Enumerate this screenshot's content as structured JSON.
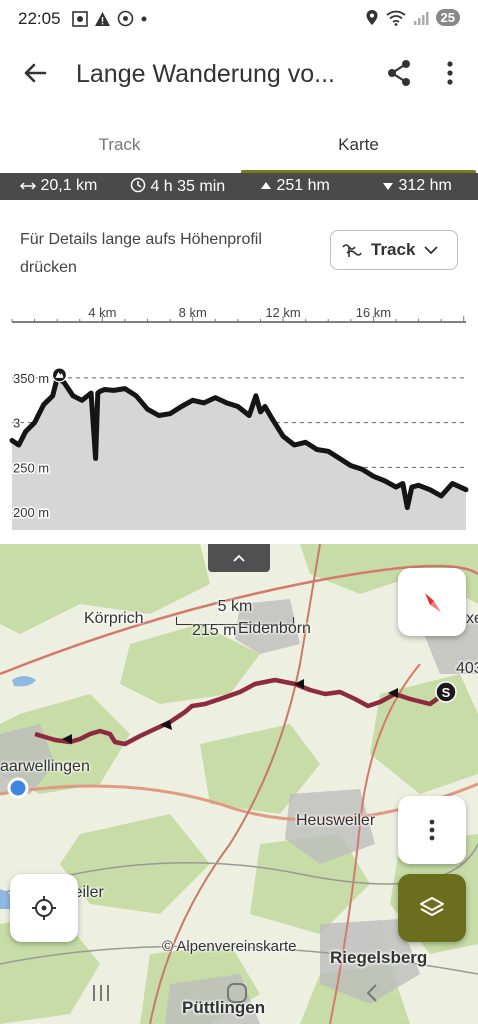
{
  "status_bar": {
    "time": "22:05",
    "battery": "25",
    "icons_left": [
      "screenshot-icon",
      "warning-icon",
      "whatsapp-icon",
      "dot-icon"
    ],
    "icons_right": [
      "location-icon",
      "wifi-icon",
      "signal-icon"
    ]
  },
  "app_bar": {
    "title": "Lange Wanderung vo...",
    "icons": [
      "back-arrow-icon",
      "share-icon",
      "more-vert-icon"
    ]
  },
  "tabs": [
    {
      "label": "Track",
      "active": false
    },
    {
      "label": "Karte",
      "active": true
    }
  ],
  "stats": {
    "distance": "20,1 km",
    "duration": "4 h 35 min",
    "ascent": "251 hm",
    "descent": "312 hm"
  },
  "profile": {
    "hint": "Für Details lange aufs Höhenprofil drücken",
    "track_select": "Track"
  },
  "chart_data": {
    "type": "area",
    "x_ticks": [
      "4 km",
      "8 km",
      "12 km",
      "16 km"
    ],
    "y_ticks": [
      "350 m",
      "3",
      "250 m",
      "200 m"
    ],
    "ylim": [
      180,
      370
    ],
    "xlim": [
      0,
      20.1
    ],
    "x": [
      0,
      0.3,
      0.6,
      1.0,
      1.4,
      1.8,
      2.0,
      2.3,
      2.7,
      3.1,
      3.5,
      3.7,
      3.8,
      3.9,
      4.1,
      4.5,
      5.0,
      5.5,
      6.0,
      6.5,
      7.0,
      7.5,
      8.0,
      8.5,
      9.0,
      9.5,
      10.0,
      10.5,
      10.8,
      11.0,
      11.2,
      11.5,
      12.0,
      12.5,
      13.0,
      13.5,
      14.0,
      14.5,
      15.0,
      15.5,
      16.0,
      16.5,
      17.0,
      17.3,
      17.5,
      17.7,
      18.0,
      18.5,
      19.0,
      19.5,
      20.1
    ],
    "values": [
      280,
      275,
      290,
      300,
      320,
      330,
      350,
      345,
      330,
      325,
      333,
      260,
      333,
      335,
      337,
      336,
      338,
      330,
      315,
      308,
      310,
      318,
      325,
      322,
      328,
      322,
      318,
      308,
      330,
      312,
      318,
      305,
      285,
      275,
      278,
      270,
      268,
      260,
      252,
      248,
      240,
      235,
      228,
      232,
      205,
      228,
      230,
      225,
      218,
      232,
      225
    ],
    "markers": [
      {
        "x": 2.1,
        "label": "summit-icon"
      }
    ]
  },
  "map": {
    "scale_top": "5 km",
    "scale_bottom": "215 m",
    "labels": {
      "korprich": "Körprich",
      "eidenborn": "Eidenborn",
      "saarwellingen": "aarwellingen",
      "heusweiler": "Heusweiler",
      "weiler": "weiler",
      "riegelsberg": "Riegelsberg",
      "puettlingen": "Püttlingen",
      "copyright": "© Alpenvereinskarte",
      "num403": "403",
      "edge_x": "xe"
    },
    "start_marker": "S",
    "colors": {
      "route": "#8e2a40",
      "map_green": "#c4dba3",
      "map_light": "#eef2e2",
      "accent_olive": "#6b6f1d"
    }
  }
}
